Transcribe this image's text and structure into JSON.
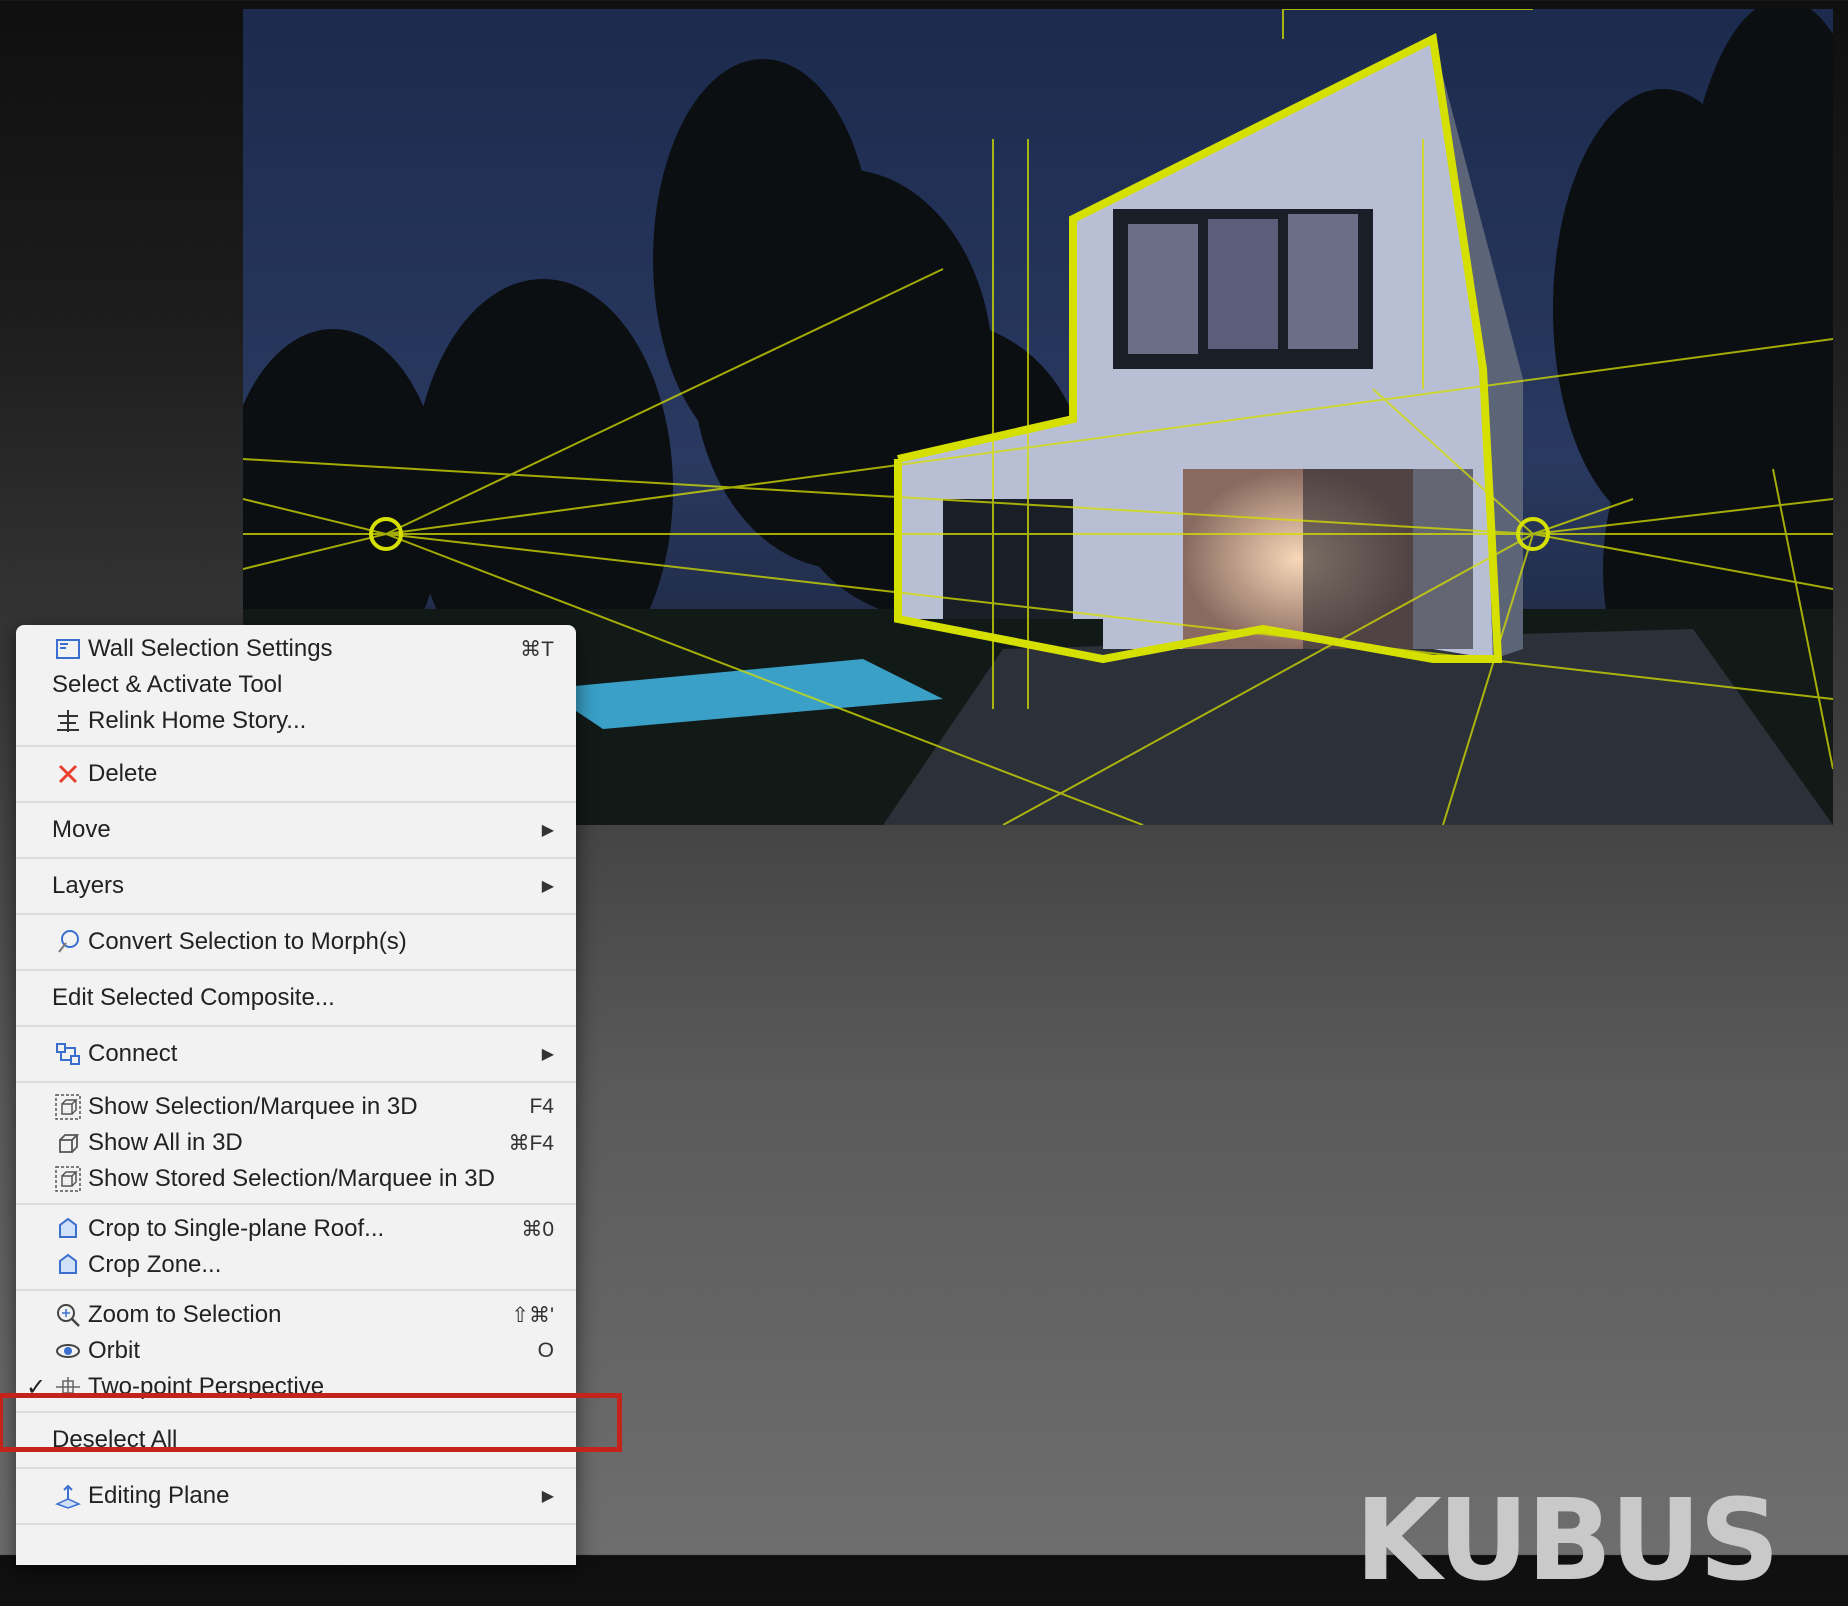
{
  "render_image": {
    "description_icon": "house-render-icon",
    "accent_color": "#d6e000"
  },
  "menu": {
    "groups": [
      {
        "items": [
          {
            "icon": "wall-settings-icon",
            "label": "Wall Selection Settings",
            "shortcut": "⌘T"
          },
          {
            "icon": "",
            "label": "Select & Activate Tool",
            "shortcut": ""
          },
          {
            "icon": "relink-story-icon",
            "label": "Relink Home Story...",
            "shortcut": ""
          }
        ]
      },
      {
        "items": [
          {
            "icon": "delete-x-icon",
            "label": "Delete",
            "shortcut": ""
          }
        ]
      },
      {
        "items": [
          {
            "icon": "",
            "label": "Move",
            "submenu": true
          }
        ]
      },
      {
        "items": [
          {
            "icon": "",
            "label": "Layers",
            "submenu": true
          }
        ]
      },
      {
        "items": [
          {
            "icon": "morph-icon",
            "label": "Convert Selection to Morph(s)",
            "shortcut": ""
          }
        ]
      },
      {
        "items": [
          {
            "icon": "",
            "label": "Edit Selected Composite...",
            "shortcut": ""
          }
        ]
      },
      {
        "items": [
          {
            "icon": "connect-icon",
            "label": "Connect",
            "submenu": true
          }
        ]
      },
      {
        "items": [
          {
            "icon": "show-selection-3d-icon",
            "label": "Show Selection/Marquee in 3D",
            "shortcut": "F4"
          },
          {
            "icon": "show-all-3d-icon",
            "label": "Show All in 3D",
            "shortcut": "⌘F4"
          },
          {
            "icon": "show-stored-3d-icon",
            "label": "Show Stored Selection/Marquee in 3D",
            "shortcut": ""
          }
        ]
      },
      {
        "items": [
          {
            "icon": "crop-roof-icon",
            "label": "Crop to Single-plane Roof...",
            "shortcut": "⌘0"
          },
          {
            "icon": "crop-zone-icon",
            "label": "Crop Zone...",
            "shortcut": ""
          }
        ]
      },
      {
        "items": [
          {
            "icon": "zoom-selection-icon",
            "label": "Zoom to Selection",
            "shortcut": "⇧⌘'"
          },
          {
            "icon": "orbit-icon",
            "label": "Orbit",
            "shortcut": "O"
          },
          {
            "icon": "two-point-perspective-icon",
            "label": "Two-point Perspective",
            "shortcut": "",
            "checked": true,
            "check_mark": "✓"
          }
        ]
      },
      {
        "items": [
          {
            "icon": "",
            "label": "Deselect All",
            "shortcut": ""
          }
        ]
      },
      {
        "items": [
          {
            "icon": "editing-plane-icon",
            "label": "Editing Plane",
            "submenu": true
          }
        ]
      }
    ],
    "submenu_arrow": "▶"
  },
  "brand": {
    "text": "KUBUS"
  },
  "highlight_color": "#c4231a"
}
